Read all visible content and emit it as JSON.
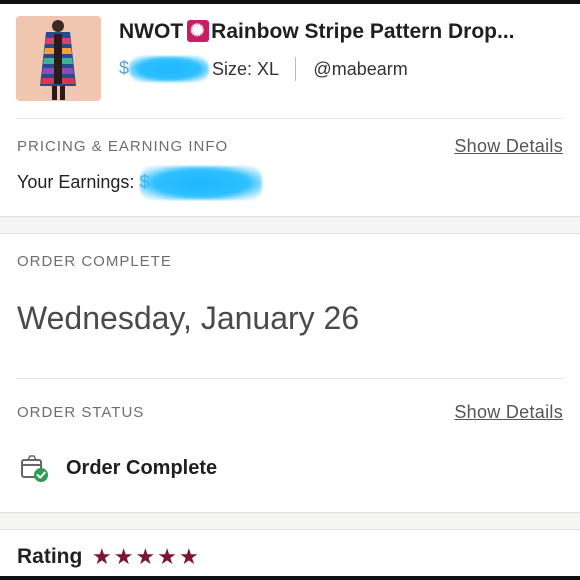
{
  "listing": {
    "title_prefix": "NWOT",
    "title_rest": "Rainbow Stripe Pattern Drop...",
    "price_symbol": "$",
    "size_text": "Size: XL",
    "seller": "@mabearm",
    "title_icon": "sparkle-emoji-icon"
  },
  "pricing": {
    "section_label": "PRICING & EARNING INFO",
    "details_link": "Show Details",
    "earnings_label": "Your Earnings:",
    "earnings_symbol": "$"
  },
  "order_complete": {
    "section_label": "ORDER COMPLETE",
    "date": "Wednesday, January 26"
  },
  "order_status": {
    "section_label": "ORDER STATUS",
    "details_link": "Show Details",
    "status_text": "Order Complete",
    "status_icon": "package-check-icon"
  },
  "rating": {
    "label": "Rating",
    "stars": 5,
    "star_color": "#7b1730"
  },
  "colors": {
    "redaction": "#2ec0ff",
    "text": "#2a2a2a",
    "muted": "#6e6e6e"
  }
}
